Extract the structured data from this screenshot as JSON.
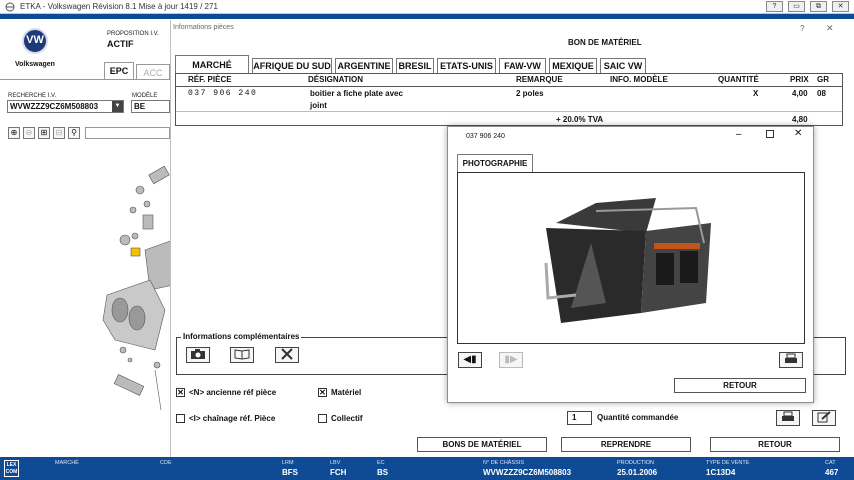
{
  "app": {
    "title": "ETKA - Volkswagen Révision 8.1 Mise à jour 1419 / 271"
  },
  "window_controls": [
    "?",
    "▭",
    "⧉",
    "✕"
  ],
  "left": {
    "brand": "Volkswagen",
    "brand_logo": "VW",
    "prop_label": "PROPOSITION I.V.",
    "prop_value": "ACTIF",
    "tab_epc": "EPC",
    "tab_acc": "ACC",
    "recherche_label": "RECHERCHE I.V.",
    "recherche_value": "WVWZZZ9CZ6M508803",
    "modele_label": "MODÈLE",
    "modele_value": "BE"
  },
  "dialog": {
    "title": "Informations pièces",
    "help": "?",
    "close": "✕",
    "bon_label": "BON DE MATÉRIEL",
    "tabs": [
      "MARCHÉ LOCAL",
      "AFRIQUE DU SUD",
      "ARGENTINE",
      "BRESIL",
      "ETATS-UNIS",
      "FAW-VW",
      "MEXIQUE",
      "SAIC VW"
    ],
    "columns": {
      "ref": "RÉF. PIÈCE",
      "designation": "DÉSIGNATION",
      "remarque": "REMARQUE",
      "info_modele": "INFO. MODÈLE",
      "quantite": "QUANTITÉ",
      "prix": "PRIX",
      "gr": "GR"
    },
    "row": {
      "ref": "037 906 240",
      "designation_1": "boitier a fiche plate avec",
      "designation_2": "joint",
      "remarque": "2 poles",
      "info_modele": "",
      "quantite": "X",
      "prix": "4,00",
      "gr": "08"
    },
    "tva_label": "+ 20.0% TVA",
    "tva_value": "4,80",
    "info_comp_label": "Informations complémentaires",
    "check_ancienne": "<N> ancienne réf pièce",
    "check_materiel": "Matériel",
    "check_chainage": "<I> chaînage réf. Pièce",
    "check_collectif": "Collectif",
    "qty_value": "1",
    "qty_label": "Quantité commandée",
    "btn_bons": "BONS DE MATÉRIEL",
    "btn_reprendre": "REPRENDRE",
    "btn_retour": "RETOUR"
  },
  "photo": {
    "title": "037 906 240",
    "tab": "PHOTOGRAPHIE",
    "btn_retour": "RETOUR"
  },
  "status": {
    "logo": "LEX COM",
    "marche_label": "MARCHÉ",
    "cde_label": "CDE",
    "lrm_label": "LRM",
    "lrm_value": "BFS",
    "lbv_label": "LBV",
    "lbv_value": "FCH",
    "ec_label": "EC",
    "ec_value": "BS",
    "chassis_label": "N° DE CHÂSSIS",
    "chassis_value": "WVWZZZ9CZ6M508803",
    "production_label": "PRODUCTION",
    "production_value": "25.01.2006",
    "type_vente_label": "TYPE DE VENTE",
    "type_vente_value": "1C13D4",
    "cat_label": "CAT",
    "cat_value": "467"
  },
  "colors": {
    "status_blue": "#0f4a94",
    "dialog_bg": "#ffffff",
    "frame": "#555555"
  }
}
